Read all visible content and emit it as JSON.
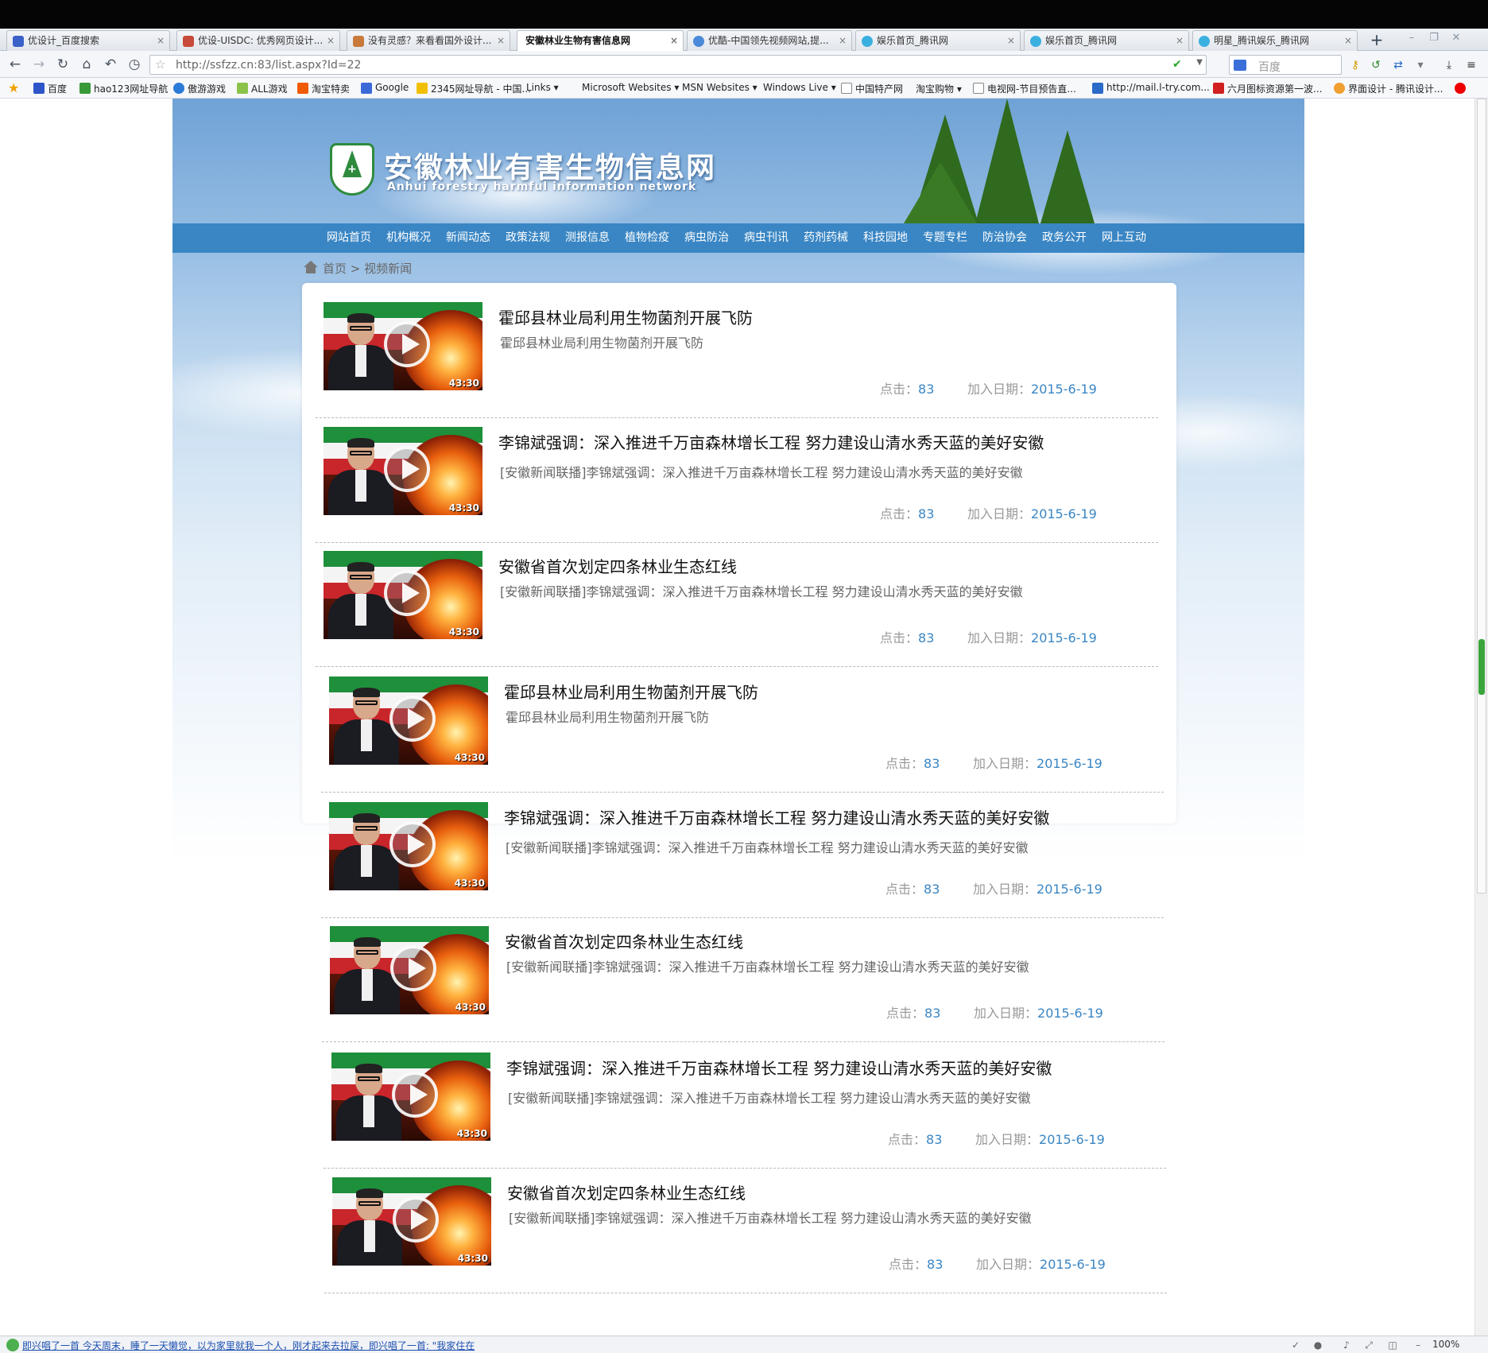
{
  "browser": {
    "tabs": [
      {
        "label": "优设计_百度搜索",
        "active": false
      },
      {
        "label": "优设-UISDC: 优秀网页设计...",
        "active": false
      },
      {
        "label": "没有灵感？来看看国外设计...",
        "active": false
      },
      {
        "label": "安徽林业生物有害信息网",
        "active": true
      },
      {
        "label": "优酷-中国领先视频网站,提...",
        "active": false
      },
      {
        "label": "娱乐首页_腾讯网",
        "active": false
      },
      {
        "label": "娱乐首页_腾讯网",
        "active": false
      },
      {
        "label": "明星_腾讯娱乐_腾讯网",
        "active": false
      }
    ],
    "url": "http://ssfzz.cn:83/list.aspx?Id=22",
    "search_placeholder": "百度",
    "favorites": [
      "百度",
      "hao123网址导航",
      "傲游游戏",
      "ALL游戏",
      "淘宝特卖",
      "Google",
      "2345网址导航 - 中国...",
      "Links",
      "Microsoft Websites",
      "MSN Websites",
      "Windows Live",
      "中国特产网",
      "淘宝购物",
      "电视网-节目预告直...",
      "http://mail.l-try.com...",
      "六月图标资源第一波...",
      "界面设计 - 腾讯设计..."
    ],
    "status_news": "即兴唱了一首 今天周末，睡了一天懒觉，以为家里就我一个人，刚才起来去拉屎，即兴唱了一首: \"我家住在",
    "zoom": "100%"
  },
  "site": {
    "title": "安徽林业有害生物信息网",
    "subtitle": "Anhui forestry harmful information network",
    "nav": [
      "网站首页",
      "机构概况",
      "新闻动态",
      "政策法规",
      "测报信息",
      "植物检疫",
      "病虫防治",
      "病虫刊讯",
      "药剂药械",
      "科技园地",
      "专题专栏",
      "防治协会",
      "政务公开",
      "网上互动"
    ],
    "breadcrumb": "首页 > 视频新闻"
  },
  "video_list": [
    {
      "title": "霍邱县林业局利用生物菌剂开展飞防",
      "desc": "霍邱县林业局利用生物菌剂开展飞防",
      "duration": "43:30",
      "clicks_label": "点击：",
      "clicks": "83",
      "date_label": "加入日期：",
      "date": "2015-6-19"
    },
    {
      "title": "李锦斌强调：深入推进千万亩森林增长工程 努力建设山清水秀天蓝的美好安徽",
      "desc": "[安徽新闻联播]李锦斌强调：深入推进千万亩森林增长工程 努力建设山清水秀天蓝的美好安徽",
      "duration": "43:30",
      "clicks_label": "点击：",
      "clicks": "83",
      "date_label": "加入日期：",
      "date": "2015-6-19"
    },
    {
      "title": "安徽省首次划定四条林业生态红线",
      "desc": "[安徽新闻联播]李锦斌强调：深入推进千万亩森林增长工程 努力建设山清水秀天蓝的美好安徽",
      "duration": "43:30",
      "clicks_label": "点击：",
      "clicks": "83",
      "date_label": "加入日期：",
      "date": "2015-6-19"
    },
    {
      "title": "霍邱县林业局利用生物菌剂开展飞防",
      "desc": "霍邱县林业局利用生物菌剂开展飞防",
      "duration": "43:30",
      "clicks_label": "点击：",
      "clicks": "83",
      "date_label": "加入日期：",
      "date": "2015-6-19"
    },
    {
      "title": "李锦斌强调：深入推进千万亩森林增长工程 努力建设山清水秀天蓝的美好安徽",
      "desc": "[安徽新闻联播]李锦斌强调：深入推进千万亩森林增长工程 努力建设山清水秀天蓝的美好安徽",
      "duration": "43:30",
      "clicks_label": "点击：",
      "clicks": "83",
      "date_label": "加入日期：",
      "date": "2015-6-19"
    },
    {
      "title": "安徽省首次划定四条林业生态红线",
      "desc": "[安徽新闻联播]李锦斌强调：深入推进千万亩森林增长工程 努力建设山清水秀天蓝的美好安徽",
      "duration": "43:30",
      "clicks_label": "点击：",
      "clicks": "83",
      "date_label": "加入日期：",
      "date": "2015-6-19"
    },
    {
      "title": "李锦斌强调：深入推进千万亩森林增长工程 努力建设山清水秀天蓝的美好安徽",
      "desc": "[安徽新闻联播]李锦斌强调：深入推进千万亩森林增长工程 努力建设山清水秀天蓝的美好安徽",
      "duration": "43:30",
      "clicks_label": "点击：",
      "clicks": "83",
      "date_label": "加入日期：",
      "date": "2015-6-19"
    },
    {
      "title": "安徽省首次划定四条林业生态红线",
      "desc": "[安徽新闻联播]李锦斌强调：深入推进千万亩森林增长工程 努力建设山清水秀天蓝的美好安徽",
      "duration": "43:30",
      "clicks_label": "点击：",
      "clicks": "83",
      "date_label": "加入日期：",
      "date": "2015-6-19"
    }
  ],
  "colors": {
    "nav_bg": "#3a86c4",
    "link_blue": "#3a86c4",
    "logo_green": "#2e8b3e"
  }
}
